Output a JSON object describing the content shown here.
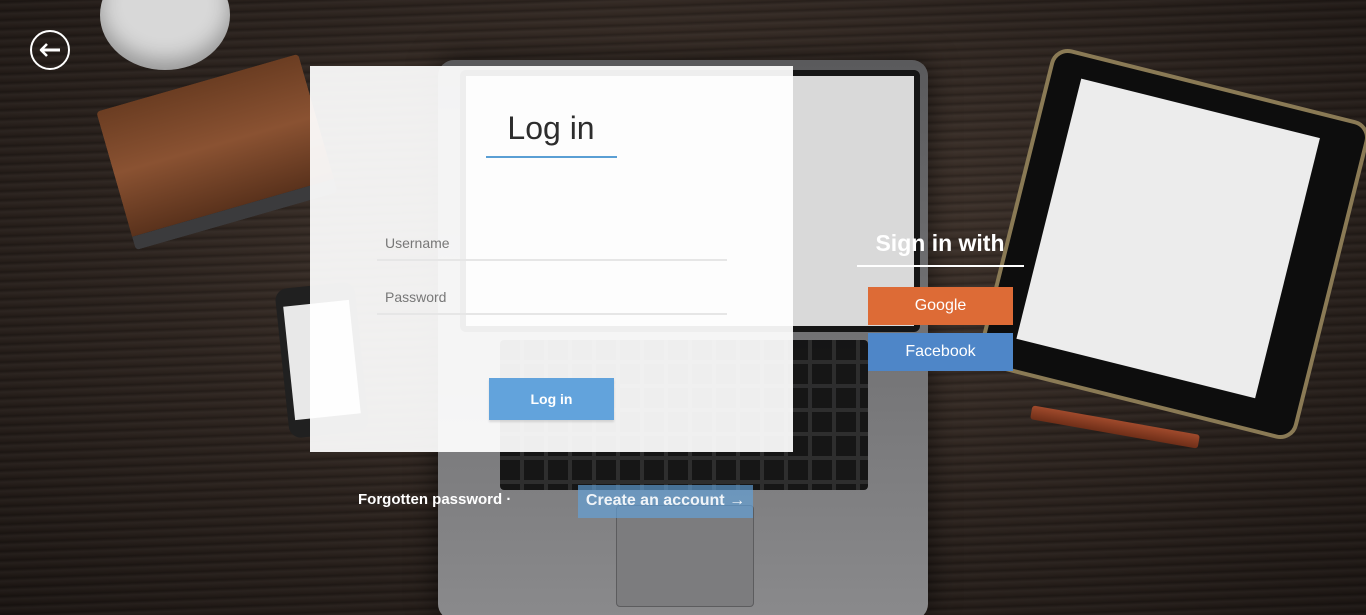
{
  "back": {
    "icon": "arrow-left-icon"
  },
  "login_card": {
    "title": "Log in",
    "username_placeholder": "Username",
    "username_value": "",
    "password_placeholder": "Password",
    "password_value": "",
    "submit_label": "Log in"
  },
  "social": {
    "title": "Sign in with",
    "google_label": "Google",
    "facebook_label": "Facebook"
  },
  "footer": {
    "forgot_label": "Forgotten password ·",
    "create_label": "Create an account →"
  },
  "colors": {
    "accent_blue": "#62a3dc",
    "google": "#dd6b36",
    "facebook": "#4e86c8"
  }
}
